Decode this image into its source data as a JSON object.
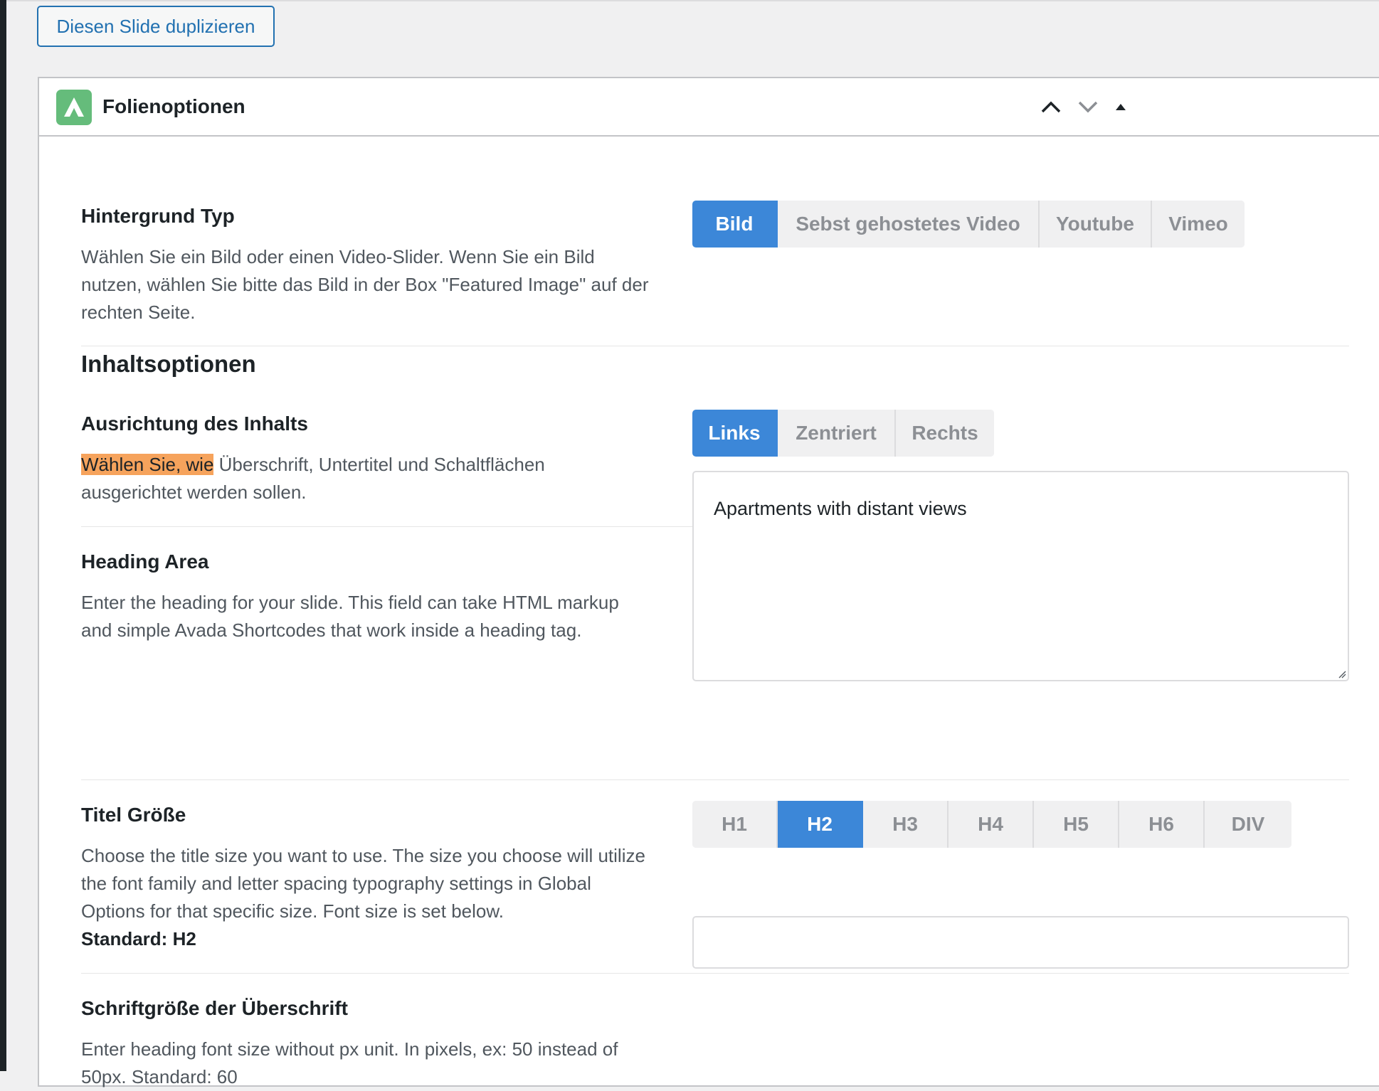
{
  "top": {
    "duplicate_button": "Diesen Slide duplizieren"
  },
  "panel": {
    "title": "Folienoptionen",
    "logo_icon": "avada-logo-icon",
    "controls": [
      "chevron-up-icon",
      "chevron-down-icon",
      "triangle-up-icon"
    ]
  },
  "background_type": {
    "label": "Hintergrund Typ",
    "description": "Wählen Sie ein Bild oder einen Video-Slider. Wenn Sie ein Bild nutzen, wählen Sie bitte das Bild in der Box \"Featured Image\" auf der rechten Seite.",
    "options": [
      "Bild",
      "Sebst gehostetes Video",
      "Youtube",
      "Vimeo"
    ],
    "selected": "Bild"
  },
  "content_section": {
    "title": "Inhaltsoptionen"
  },
  "alignment": {
    "label": "Ausrichtung des Inhalts",
    "description_highlight": "Wählen Sie, wie",
    "description_rest": " Überschrift, Untertitel und Schaltflächen ausgerichtet werden sollen.",
    "options": [
      "Links",
      "Zentriert",
      "Rechts"
    ],
    "selected": "Links"
  },
  "heading_area": {
    "label": "Heading Area",
    "description": "Enter the heading for your slide. This field can take HTML markup and simple Avada Shortcodes that work inside a heading tag.",
    "value": "Apartments with distant views"
  },
  "title_size": {
    "label": "Titel Größe",
    "description": "Choose the title size you want to use. The size you choose will utilize the font family and letter spacing typography settings in Global Options for that specific size. Font size is set below.",
    "default_text": "Standard: H2",
    "options": [
      "H1",
      "H2",
      "H3",
      "H4",
      "H5",
      "H6",
      "DIV"
    ],
    "selected": "H2"
  },
  "heading_font_size": {
    "label": "Schriftgröße der Überschrift",
    "description": "Enter heading font size without px unit. In pixels, ex: 50 instead of 50px. Standard: 60",
    "value": ""
  },
  "colors": {
    "accent": "#3c87d8",
    "link": "#2271b1",
    "logo_green": "#65bc7b",
    "highlight": "#f6a35c"
  }
}
